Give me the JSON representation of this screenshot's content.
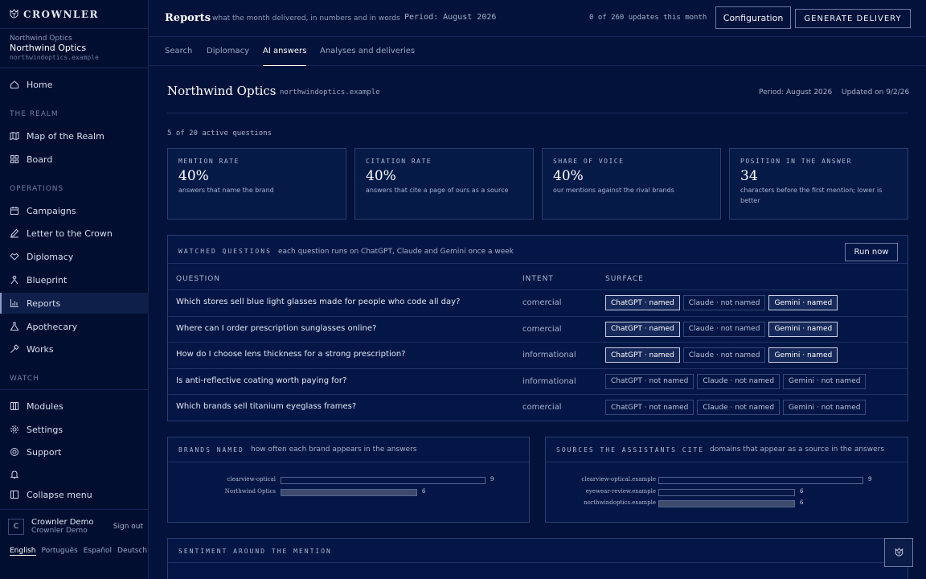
{
  "app": {
    "brand": "CROWNLER"
  },
  "org": {
    "label": "Northwind Optics",
    "title": "Northwind Optics",
    "domain": "northwindoptics.example"
  },
  "nav": {
    "home": "Home",
    "section_realm": "THE REALM",
    "map": "Map of the Realm",
    "board": "Board",
    "section_ops": "OPERATIONS",
    "campaigns": "Campaigns",
    "letter": "Letter to the Crown",
    "diplomacy": "Diplomacy",
    "blueprint": "Blueprint",
    "reports": "Reports",
    "apothecary": "Apothecary",
    "works": "Works",
    "section_watch": "WATCH",
    "modules": "Modules",
    "settings": "Settings",
    "support": "Support",
    "collapse": "Collapse menu"
  },
  "user": {
    "initial": "C",
    "name": "Crownler Demo",
    "org": "Crownler Demo",
    "signout": "Sign out"
  },
  "languages": [
    "English",
    "Português",
    "Español",
    "Deutsch"
  ],
  "topbar": {
    "title": "Reports",
    "subtitle": "what the month delivered, in numbers and in words",
    "period": "Period: August 2026",
    "updates": "0 of 260 updates this month",
    "config": "Configuration",
    "generate": "GENERATE DELIVERY"
  },
  "tabs": [
    "Search",
    "Diplomacy",
    "AI answers",
    "Analyses and deliveries"
  ],
  "page": {
    "title": "Northwind Optics",
    "domain": "northwindoptics.example",
    "period": "Period: August 2026",
    "updated": "Updated on 9/2/26",
    "active": "5 of 20 active questions"
  },
  "cards": [
    {
      "label": "MENTION RATE",
      "value": "40%",
      "desc": "answers that name the brand"
    },
    {
      "label": "CITATION RATE",
      "value": "40%",
      "desc": "answers that cite a page of ours as a source"
    },
    {
      "label": "SHARE OF VOICE",
      "value": "40%",
      "desc": "our mentions against the rival brands"
    },
    {
      "label": "POSITION IN THE ANSWER",
      "value": "34",
      "desc": "characters before the first mention; lower is better"
    }
  ],
  "watched": {
    "title": "WATCHED QUESTIONS",
    "subtitle": "each question runs on ChatGPT, Claude and Gemini once a week",
    "run": "Run now",
    "headers": [
      "QUESTION",
      "INTENT",
      "SURFACE"
    ],
    "rows": [
      {
        "q": "Which stores sell blue light glasses made for people who code all day?",
        "intent": "comercial",
        "chips": [
          {
            "t": "ChatGPT · named",
            "n": true
          },
          {
            "t": "Claude · not named",
            "n": false
          },
          {
            "t": "Gemini · named",
            "n": true
          }
        ]
      },
      {
        "q": "Where can I order prescription sunglasses online?",
        "intent": "comercial",
        "chips": [
          {
            "t": "ChatGPT · named",
            "n": true
          },
          {
            "t": "Claude · not named",
            "n": false
          },
          {
            "t": "Gemini · named",
            "n": true
          }
        ]
      },
      {
        "q": "How do I choose lens thickness for a strong prescription?",
        "intent": "informational",
        "chips": [
          {
            "t": "ChatGPT · named",
            "n": true
          },
          {
            "t": "Claude · not named",
            "n": false
          },
          {
            "t": "Gemini · named",
            "n": true
          }
        ]
      },
      {
        "q": "Is anti-reflective coating worth paying for?",
        "intent": "informational",
        "chips": [
          {
            "t": "ChatGPT · not named",
            "n": false
          },
          {
            "t": "Claude · not named",
            "n": false
          },
          {
            "t": "Gemini · not named",
            "n": false
          }
        ]
      },
      {
        "q": "Which brands sell titanium eyeglass frames?",
        "intent": "comercial",
        "chips": [
          {
            "t": "ChatGPT · not named",
            "n": false
          },
          {
            "t": "Claude · not named",
            "n": false
          },
          {
            "t": "Gemini · not named",
            "n": false
          }
        ]
      }
    ]
  },
  "brands": {
    "title": "BRANDS NAMED",
    "subtitle": "how often each brand appears in the answers",
    "max": 9,
    "items": [
      {
        "name": "clearview-optical",
        "value": 9,
        "own": false
      },
      {
        "name": "Northwind Optics",
        "value": 6,
        "own": true
      }
    ]
  },
  "sources": {
    "title": "SOURCES THE ASSISTANTS CITE",
    "subtitle": "domains that appear as a source in the answers",
    "max": 9,
    "items": [
      {
        "name": "clearview-optical.example",
        "value": 9,
        "own": false
      },
      {
        "name": "eyewear-review.example",
        "value": 6,
        "own": false
      },
      {
        "name": "northwindoptics.example",
        "value": 6,
        "own": true
      }
    ]
  },
  "sentiment": {
    "title": "SENTIMENT AROUND THE MENTION"
  }
}
